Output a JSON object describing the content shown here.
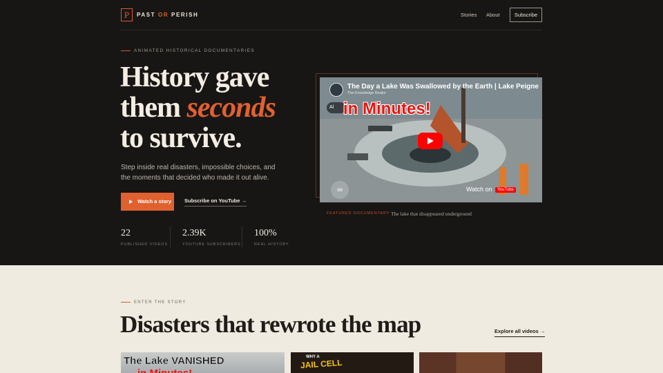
{
  "brand": {
    "mark": "P",
    "word1": "PAST",
    "word2": "OR",
    "word3": "PERISH"
  },
  "nav": {
    "stories": "Stories",
    "about": "About",
    "subscribe": "Subscribe"
  },
  "hero": {
    "eyebrow": "ANIMATED HISTORICAL DOCUMENTARIES",
    "line1": "History gave",
    "line2a": "them ",
    "line2b": "seconds",
    "line3": "to survive.",
    "subtitle": "Step inside real disasters, impossible choices, and the moments that decided who made it out alive.",
    "watch_label": "Watch a story",
    "subscribe_label": "Subscribe on YouTube",
    "stats": [
      {
        "value": "22",
        "label": "PUBLISHED VIDEOS"
      },
      {
        "value": "2.39K",
        "label": "YOUTUBE SUBSCRIBERS"
      },
      {
        "value": "100%",
        "label": "REAL HISTORY"
      }
    ]
  },
  "video": {
    "title": "The Day a Lake Was Swallowed by the Earth | Lake Peigne",
    "channel": "The Knowledge Realm",
    "overlay_text": "in Minutes!",
    "info_label": "Al",
    "watch_on": "Watch on",
    "youtube": "YouTube"
  },
  "featured": {
    "tag": "FEATURED DOCUMENTARY",
    "caption": "The lake that disappeared underground"
  },
  "section": {
    "eyebrow": "ENTER THE STORY",
    "title": "Disasters that rewrote the map",
    "explore": "Explore all videos"
  },
  "cards": {
    "c1_title": "The Lake VANISHED",
    "c1_sub": "in Minutes!",
    "c2_why": "WHY A",
    "c2_jail": "JAIL CELL"
  }
}
